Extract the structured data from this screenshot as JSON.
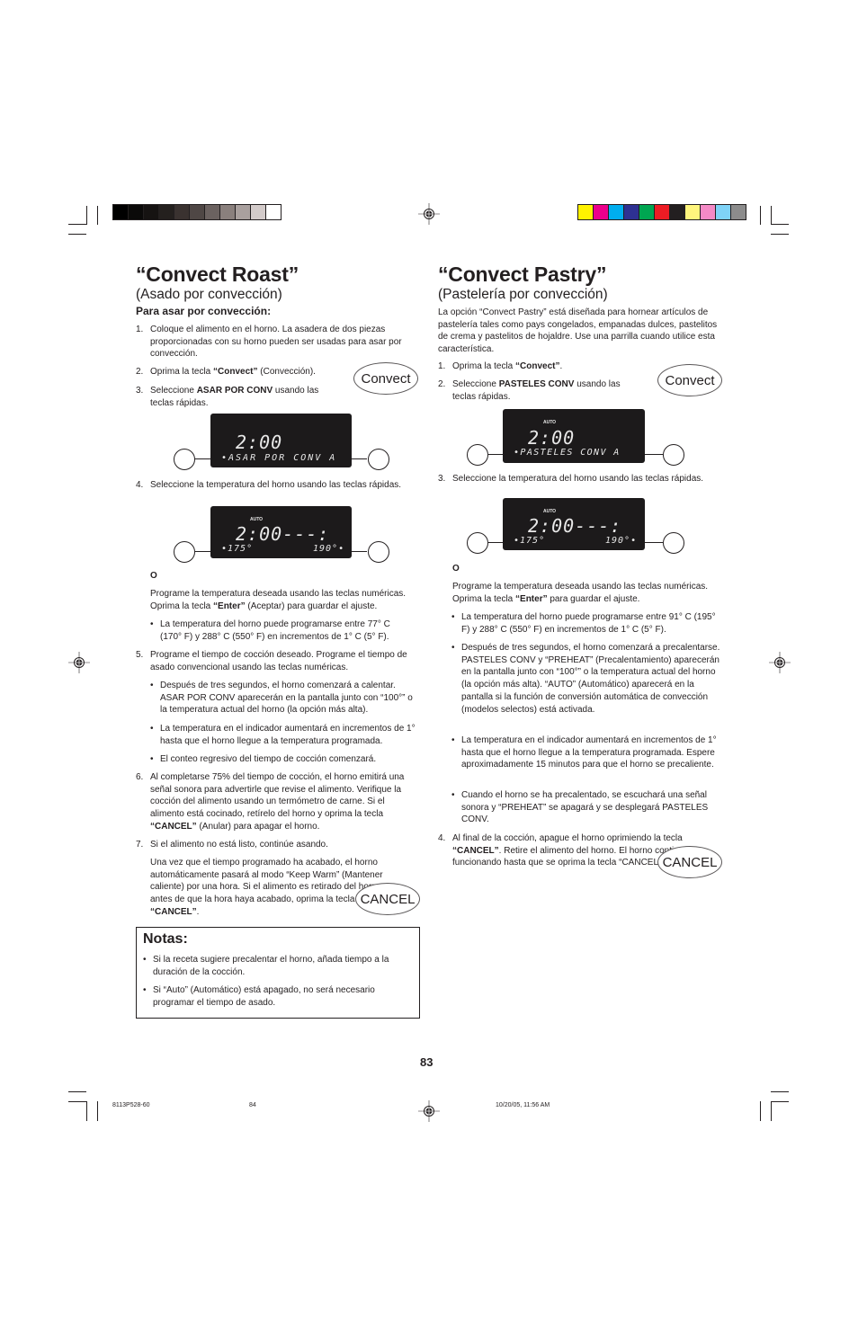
{
  "print_marks": {
    "grayscale_swatches": [
      "#000000",
      "#0b0a09",
      "#161312",
      "#24201e",
      "#3a3230",
      "#4f4745",
      "#6b6260",
      "#8a807d",
      "#a9a09e",
      "#d3cbca",
      "#ffffff"
    ],
    "color_swatches": [
      "#fff200",
      "#ec008c",
      "#00aeef",
      "#2e3192",
      "#00a651",
      "#ed1c24",
      "#231f20",
      "#fff57d",
      "#f58ac6",
      "#7fd3f7",
      "#8c8c8c"
    ]
  },
  "left": {
    "title": "“Convect Roast”",
    "subtitle": "(Asado por convección)",
    "section_heading": "Para asar por convección:",
    "steps": {
      "s1_num": "1.",
      "s1": "Coloque el alimento en el horno. La asadera de dos piezas proporcionadas con su horno pueden ser usadas para asar por convección.",
      "s2_num": "2.",
      "s2_pre": "Oprima la tecla ",
      "s2_bold": "“Convect”",
      "s2_post": " (Convección).",
      "s3_num": "3.",
      "s3_pre": "Seleccione ",
      "s3_bold": "ASAR POR CONV",
      "s3_post": " usando las teclas rápidas.",
      "s4_num": "4.",
      "s4": "Seleccione la temperatura del horno usando las teclas rápidas.",
      "or": "O",
      "s4b_pre": "Programe la temperatura deseada usando las teclas numéricas. Oprima la tecla ",
      "s4b_bold": "“Enter”",
      "s4b_post": " (Aceptar) para guardar el ajuste.",
      "s4_bullet": "La temperatura del horno puede programarse entre 77° C (170° F) y 288° C (550° F) en incrementos de 1° C (5° F).",
      "s5_num": "5.",
      "s5": "Programe el tiempo de cocción deseado. Programe el tiempo de asado convencional usando las teclas numéricas.",
      "s5_b1": "Después de tres segundos, el horno comenzará a calentar. ASAR POR CONV aparecerán en la pantalla junto con “100°” o la temperatura actual del horno (la opción más alta).",
      "s5_b2": "La temperatura en el indicador aumentará en incrementos de 1° hasta que el horno llegue a la temperatura programada.",
      "s5_b3": "El conteo regresivo del tiempo de cocción comenzará.",
      "s6_num": "6.",
      "s6_pre": "Al completarse 75% del tiempo de cocción, el horno emitirá una señal sonora para advertirle que revise el alimento.  Verifique la cocción del alimento usando un termómetro de carne. Si el alimento está cocinado, retírelo del horno y oprima la tecla ",
      "s6_bold": "“CANCEL”",
      "s6_post": " (Anular) para apagar el horno.",
      "s7_num": "7.",
      "s7": "Si el alimento no está listo, continúe asando.",
      "s7b_pre": "Una vez que el tiempo programado ha acabado, el horno automáticamente pasará al modo “Keep Warm” (Mantener caliente) por una hora.  Si el alimento es retirado del horno antes de que la hora haya acabado, oprima la tecla ",
      "s7b_bold": "“CANCEL”",
      "s7b_post": "."
    },
    "convect_key": "Convect",
    "cancel_key": "CANCEL",
    "display1": {
      "time": "2:00",
      "text": "•ASAR POR CONV  A"
    },
    "display2": {
      "auto": "AUTO",
      "time": "2:00---:",
      "left": "•175°",
      "right": "190°•"
    },
    "notes": {
      "title": "Notas:",
      "items": [
        "Si la receta sugiere precalentar el horno, añada tiempo a la duración de la cocción.",
        "Si “Auto” (Automático) está apagado, no será necesario programar el tiempo de asado."
      ]
    }
  },
  "right": {
    "title": "“Convect Pastry”",
    "subtitle": "(Pastelería por convección)",
    "intro": "La opción “Convect Pastry” está diseñada para hornear artículos de pastelería tales como pays congelados, empanadas dulces, pastelitos de crema y pastelitos de hojaldre. Use una parrilla cuando utilice esta característica.",
    "steps": {
      "s1_num": "1.",
      "s1_pre": "Oprima la tecla ",
      "s1_bold": "“Convect”",
      "s1_post": ".",
      "s2_num": "2.",
      "s2_pre": "Seleccione ",
      "s2_bold": "PASTELES CONV",
      "s2_post": " usando las teclas rápidas.",
      "s3_num": "3.",
      "s3": "Seleccione la temperatura del horno usando las teclas rápidas.",
      "or": "O",
      "s3b_pre": "Programe la temperatura deseada usando las teclas numéricas. Oprima la tecla ",
      "s3b_bold": "“Enter”",
      "s3b_post": " para guardar el ajuste.",
      "b1": "La temperatura del horno puede programarse entre 91° C (195° F) y 288° C (550° F) en incrementos de 1° C (5° F).",
      "b2": "Después de tres segundos, el horno comenzará a precalentarse.  PASTELES CONV y “PREHEAT” (Precalentamiento) aparecerán en la pantalla junto con “100°” o la temperatura actual del horno (la opción más alta). “AUTO” (Automático) aparecerá en la pantalla si la función de conversión automática de convección (modelos selectos) está activada.",
      "b3": "La temperatura en el indicador aumentará en incrementos de 1° hasta que el horno llegue a la temperatura programada. Espere aproximadamente 15 minutos para que el horno se precaliente.",
      "b4": "Cuando el horno se ha precalentado, se escuchará una señal sonora y “PREHEAT” se apagará y se desplegará PASTELES CONV.",
      "s4_num": "4.",
      "s4_pre": "Al final de la cocción, apague el horno oprimiendo la tecla ",
      "s4_bold": "“CANCEL”",
      "s4_post": ".  Retire el alimento del horno. El horno continuará funcionando hasta que se oprima la tecla “CANCEL”."
    },
    "convect_key": "Convect",
    "cancel_key": "CANCEL",
    "display1": {
      "auto": "AUTO",
      "time": "2:00",
      "text": "•PASTELES CONV  A"
    },
    "display2": {
      "auto": "AUTO",
      "time": "2:00---:",
      "left": "•175°",
      "right": "190°•"
    }
  },
  "footer": {
    "page_number": "83",
    "job_code": "8113P528-60",
    "sheet": "84",
    "timestamp": "10/20/05, 11:56 AM"
  }
}
